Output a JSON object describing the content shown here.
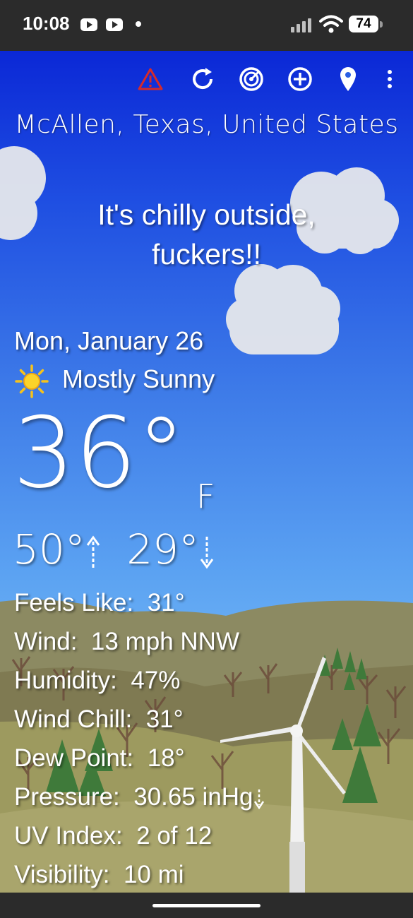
{
  "status_bar": {
    "time": "10:08",
    "battery": "74"
  },
  "toolbar": {
    "icons": [
      "alert-icon",
      "refresh-icon",
      "radar-icon",
      "add-location-icon",
      "location-pin-icon",
      "more-icon"
    ]
  },
  "location": "McAllen, Texas, United States",
  "message": {
    "line1": "It's chilly outside,",
    "line2": "fuckers!!"
  },
  "date": "Mon, January 26",
  "condition": {
    "icon": "sun-icon",
    "text": "Mostly Sunny"
  },
  "temperature": {
    "value": "36°",
    "unit": "F"
  },
  "high_low": {
    "high": "50°",
    "low": "29°"
  },
  "details": [
    {
      "label": "Feels Like:",
      "value": "31°"
    },
    {
      "label": "Wind:",
      "value": "13 mph NNW"
    },
    {
      "label": "Humidity:",
      "value": "47%"
    },
    {
      "label": "Wind Chill:",
      "value": "31°"
    },
    {
      "label": "Dew Point:",
      "value": "18°"
    },
    {
      "label": "Pressure:",
      "value": "30.65 inHg"
    },
    {
      "label": "UV Index:",
      "value": "2 of 12"
    },
    {
      "label": "Visibility:",
      "value": "10 mi"
    }
  ],
  "colors": {
    "alert": "#d62a2a",
    "sky_top": "#0b28d6",
    "sky_bottom": "#8ccdf8",
    "sun": "#f6c21c"
  }
}
